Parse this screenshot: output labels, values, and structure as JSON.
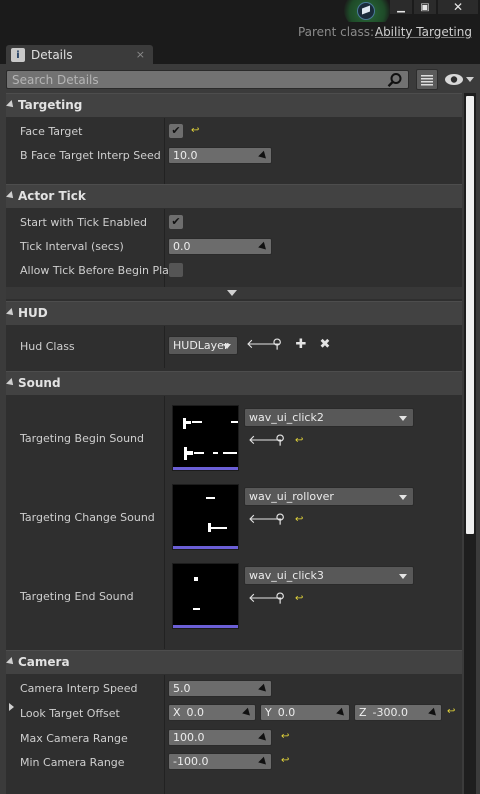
{
  "window": {
    "minimize": "▁",
    "maximize": "▣",
    "close": "✕",
    "parent_class_label": "Parent class:",
    "parent_class_value": "Ability Targeting"
  },
  "tab": {
    "label": "Details",
    "icon": "i",
    "close": "×"
  },
  "search": {
    "placeholder": "Search Details"
  },
  "sections": {
    "targeting": {
      "title": "Targeting",
      "face_target_label": "Face Target",
      "face_target_checked": true,
      "interp_label": "B Face Target Interp Seed",
      "interp_value": "10.0"
    },
    "actor_tick": {
      "title": "Actor Tick",
      "start_tick_label": "Start with Tick Enabled",
      "start_tick_checked": true,
      "tick_interval_label": "Tick Interval (secs)",
      "tick_interval_value": "0.0",
      "allow_tick_label": "Allow Tick Before Begin Play",
      "allow_tick_checked": false
    },
    "hud": {
      "title": "HUD",
      "hud_class_label": "Hud Class",
      "hud_class_value": "HUDLayer"
    },
    "sound": {
      "title": "Sound",
      "begin_label": "Targeting Begin Sound",
      "begin_value": "wav_ui_click2",
      "change_label": "Targeting Change Sound",
      "change_value": "wav_ui_rollover",
      "end_label": "Targeting End Sound",
      "end_value": "wav_ui_click3"
    },
    "camera": {
      "title": "Camera",
      "interp_speed_label": "Camera Interp Speed",
      "interp_speed_value": "5.0",
      "look_offset_label": "Look Target Offset",
      "look_x_label": "X",
      "look_x": "0.0",
      "look_y_label": "Y",
      "look_y": "0.0",
      "look_z_label": "Z",
      "look_z": "-300.0",
      "max_range_label": "Max Camera Range",
      "max_range_value": "100.0",
      "min_range_label": "Min Camera Range",
      "min_range_value": "-100.0"
    }
  },
  "icons": {
    "reset": "reset-to-default-icon",
    "use_selected": "arrow-left-icon",
    "browse": "magnifier-icon",
    "add": "plus-icon",
    "clear": "x-icon"
  },
  "colors": {
    "reset_arrow": "#e2d43a",
    "thumbnail_bar": "#6b5fd6"
  }
}
